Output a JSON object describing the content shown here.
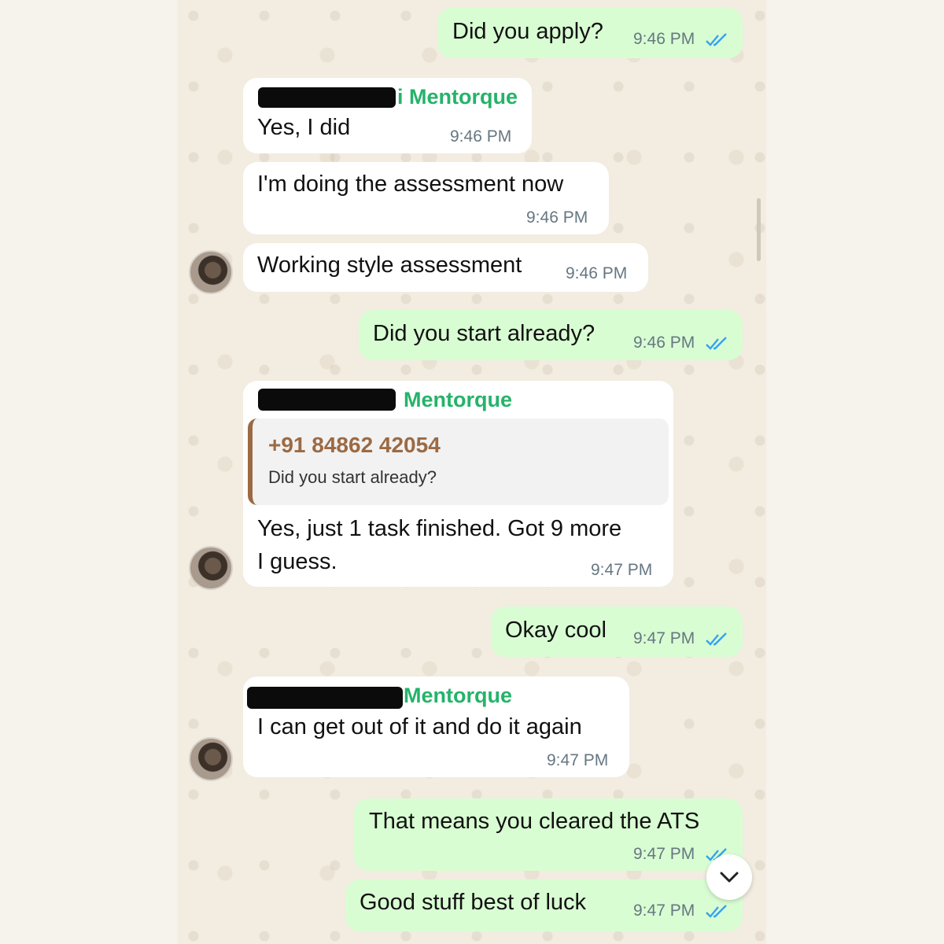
{
  "messages": [
    {
      "dir": "out",
      "text": "Did you apply?",
      "time": "9:46 PM",
      "read": true
    },
    {
      "dir": "in",
      "sender": "i Mentorque",
      "text": "Yes, I did",
      "time": "9:46 PM"
    },
    {
      "dir": "in",
      "text": "I'm doing the assessment now",
      "time": "9:46 PM"
    },
    {
      "dir": "in",
      "text": "Working style assessment",
      "time": "9:46 PM"
    },
    {
      "dir": "out",
      "text": "Did you start already?",
      "time": "9:46 PM",
      "read": true
    },
    {
      "dir": "in",
      "sender": "Mentorque",
      "quote": {
        "name": "+91 84862 42054",
        "text": "Did you start already?"
      },
      "lines": [
        "Yes, just 1 task finished. Got 9 more",
        "I guess."
      ],
      "time": "9:47 PM"
    },
    {
      "dir": "out",
      "text": "Okay cool",
      "time": "9:47 PM",
      "read": true
    },
    {
      "dir": "in",
      "sender": "Mentorque",
      "text": "I can get out of it and do it again",
      "time": "9:47 PM"
    },
    {
      "dir": "out",
      "text": "That means you cleared the ATS",
      "time": "9:47 PM",
      "read": true
    },
    {
      "dir": "out",
      "text": "Good stuff best of luck",
      "time": "9:47 PM",
      "read": true
    }
  ],
  "colors": {
    "incoming": "#ffffff",
    "outgoing": "#d9fdd3",
    "sender": "#25b36a",
    "quote_accent": "#9b6a44",
    "read_ticks": "#34a3f0"
  },
  "icons": {
    "read_receipt": "double-check-icon",
    "scroll_down": "chevron-down-icon"
  }
}
